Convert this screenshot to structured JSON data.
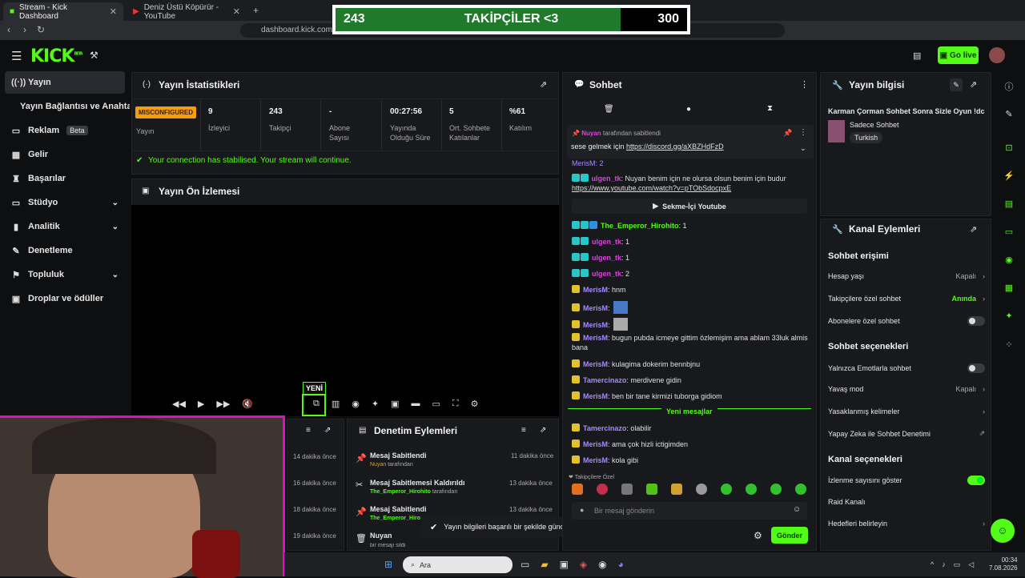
{
  "browser": {
    "tabs": [
      {
        "title": "Stream - Kick Dashboard"
      },
      {
        "title": "Deniz Üstü Köpürür - YouTube"
      }
    ],
    "url": "dashboard.kick.com/str"
  },
  "overlay": {
    "left": "243",
    "title": "TAKİPÇİLER <3",
    "right": "300",
    "progress": 0.81
  },
  "header": {
    "logo": "KICK",
    "logo_beta": "BETA",
    "go_live": "Go live"
  },
  "sidebar": {
    "items": [
      {
        "label": "Yayın"
      },
      {
        "label": "Yayın Bağlantısı ve Anahtarı"
      },
      {
        "label": "Reklam",
        "badge": "Beta"
      },
      {
        "label": "Gelir"
      },
      {
        "label": "Başarılar"
      },
      {
        "label": "Stüdyo"
      },
      {
        "label": "Analitik"
      },
      {
        "label": "Denetleme"
      },
      {
        "label": "Topluluk"
      },
      {
        "label": "Droplar ve ödüller"
      }
    ]
  },
  "stats": {
    "title": "Yayın İstatistikleri",
    "misconfigured": "MISCONFIGURED",
    "stream_label": "Yayın",
    "items": [
      {
        "value": "9",
        "label": "İzleyici"
      },
      {
        "value": "243",
        "label": "Takipçi"
      },
      {
        "value": "-",
        "label": "Abone Sayısı"
      },
      {
        "value": "00:27:56",
        "label": "Yayında Olduğu Süre"
      },
      {
        "value": "5",
        "label": "Ort. Sohbete Katılanlar"
      },
      {
        "value": "%61",
        "label": "Katılım"
      }
    ],
    "notice": "Your connection has stabilised. Your stream will continue."
  },
  "preview": {
    "title": "Yayın Ön İzlemesi",
    "new_badge": "YENİ"
  },
  "mod": {
    "title": "Denetim Eylemleri",
    "left_times": [
      "14 dakika önce",
      "16 dakika önce",
      "18 dakika önce",
      "19 dakika önce"
    ],
    "items": [
      {
        "action": "Mesaj Sabitlendi",
        "user": "Nuyan",
        "suffix": "tarafından",
        "time": "11 dakika önce"
      },
      {
        "action": "Mesaj Sabitlemesi Kaldırıldı",
        "user": "The_Emperor_Hirohito",
        "suffix": "tarafından",
        "time": "13 dakika önce"
      },
      {
        "action": "Mesaj Sabitlendi",
        "user": "The_Emperor_Hiro",
        "suffix": "",
        "time": "13 dakika önce"
      },
      {
        "action": "Nuyan",
        "user": "bir mesajı sildi",
        "suffix": "",
        "time": ""
      }
    ]
  },
  "toast": "Yayın bilgileri başarılı bir şekilde güncellendi.",
  "chat": {
    "title": "Sohbet",
    "pinned": {
      "by": "Nuyan",
      "by_suffix": "tarafından sabitlendi",
      "text": "sese gelmek için",
      "link": "https://discord.gg/aXBZHdFzD"
    },
    "partial": "MerisM: 2",
    "msg1": {
      "user": "ulgen_tk",
      "text": "Nuyan benim için ne olursa olsun benim için budur",
      "link": "https://www.youtube.com/watch?v=pTObSdocpxE"
    },
    "youtube_chip": "Sekme-İçi Youtube",
    "messages": [
      {
        "user": "The_Emperor_Hirohito",
        "text": "1",
        "color": "#53fc18"
      },
      {
        "user": "ulgen_tk",
        "text": "1",
        "color": "#e040e0"
      },
      {
        "user": "ulgen_tk",
        "text": "1",
        "color": "#e040e0"
      },
      {
        "user": "ulgen_tk",
        "text": "2",
        "color": "#e040e0"
      },
      {
        "user": "MerisM",
        "text": "hnm",
        "color": "#a78bfa"
      },
      {
        "user": "MerisM",
        "text": "",
        "color": "#a78bfa"
      },
      {
        "user": "MerisM",
        "text": "",
        "color": "#a78bfa"
      },
      {
        "user": "MerisM",
        "text": "bugun pubda icmeye gittim özlemişim ama ablam 33luk almis bana",
        "color": "#a78bfa"
      },
      {
        "user": "MerisM",
        "text": "kulagima dokerim bennbjnu",
        "color": "#a78bfa"
      },
      {
        "user": "Tamercinazo",
        "text": "merdivene gidin",
        "color": "#a78bfa"
      },
      {
        "user": "MerisM",
        "text": "ben bir tane kirmizi tuborga gidiom",
        "color": "#a78bfa"
      }
    ],
    "new_messages": "Yeni mesajlar",
    "messages2": [
      {
        "user": "Tamercinazo",
        "text": "olabilir",
        "color": "#a78bfa"
      },
      {
        "user": "MerisM",
        "text": "ama çok hizli ictigimden",
        "color": "#a78bfa"
      },
      {
        "user": "MerisM",
        "text": "kola gibi",
        "color": "#a78bfa"
      }
    ],
    "emotes_label": "Takipçilere Özel",
    "input_placeholder": "Bir mesaj gönderin",
    "send": "Gönder"
  },
  "info": {
    "title": "Yayın bilgisi",
    "stream_title": "Karman Çorman Sohbet Sonra Sizle Oyun !dc",
    "category": "Sadece Sohbet",
    "language": "Turkish"
  },
  "channel": {
    "title": "Kanal Eylemleri",
    "chat_access": "Sohbet erişimi",
    "account_age": "Hesap yaşı",
    "account_age_val": "Kapalı",
    "followers_only": "Takipçilere özel sohbet",
    "followers_only_val": "Anında",
    "subs_only": "Abonelere özel sohbet",
    "chat_options": "Sohbet seçenekleri",
    "emote_only": "Yalnızca Emotlarla sohbet",
    "slow_mode": "Yavaş mod",
    "slow_mode_val": "Kapalı",
    "banned_words": "Yasaklanmış kelimeler",
    "ai_moderation": "Yapay Zeka ile Sohbet Denetimi",
    "channel_options": "Kanal seçenekleri",
    "show_viewers": "İzlenme sayısını göster",
    "raid": "Raid Kanalı",
    "goals": "Hedefleri belirleyin"
  },
  "taskbar": {
    "search": "Ara",
    "time": "00:34",
    "date": "7.08.2026"
  }
}
